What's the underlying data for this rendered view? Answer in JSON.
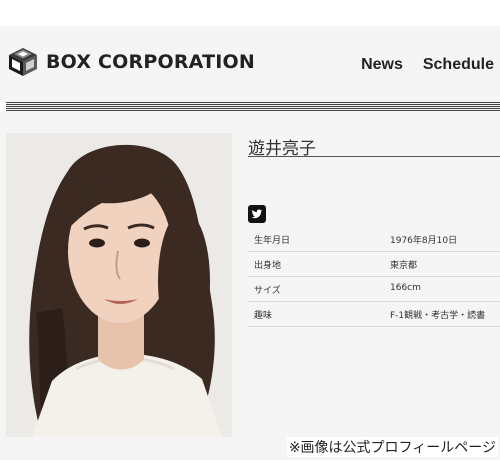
{
  "header": {
    "logo_text": "BOX CORPORATION",
    "nav": [
      {
        "label": "News"
      },
      {
        "label": "Schedule"
      }
    ]
  },
  "profile": {
    "name": "遊井亮子",
    "social_icon": "twitter-icon",
    "rows": [
      {
        "label": "生年月日",
        "value": "1976年8月10日"
      },
      {
        "label": "出身地",
        "value": "東京都"
      },
      {
        "label": "サイズ",
        "value": "166cm"
      },
      {
        "label": "趣味",
        "value": "F-1観戦・考古学・読書"
      }
    ]
  },
  "caption": "※画像は公式プロフィールページ",
  "colors": {
    "header_bg": "#f5f5f5",
    "text": "#222222",
    "twitter_bg": "#111111"
  }
}
